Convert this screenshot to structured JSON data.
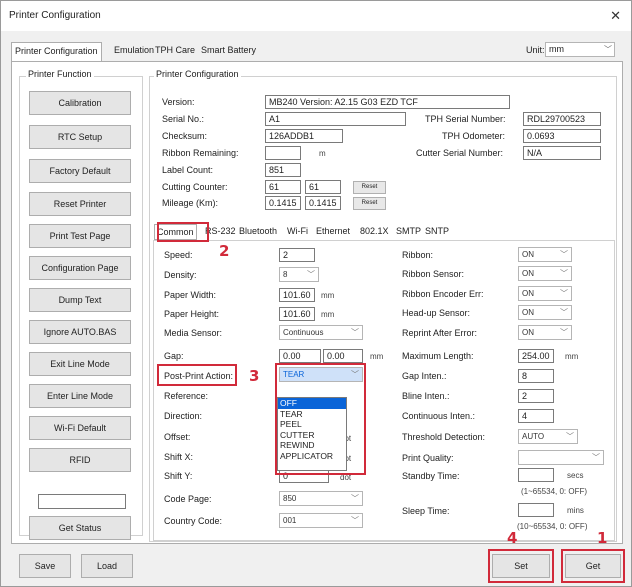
{
  "window": {
    "title": "Printer Configuration"
  },
  "tabs": [
    "Printer Configuration",
    "Emulation",
    "TPH Care",
    "Smart Battery"
  ],
  "unit": {
    "label": "Unit:",
    "value": "mm"
  },
  "printer_function": {
    "title": "Printer Function",
    "buttons": [
      "Calibration",
      "RTC Setup",
      "Factory Default",
      "Reset Printer",
      "Print Test Page",
      "Configuration Page",
      "Dump Text",
      "Ignore AUTO.BAS",
      "Exit Line Mode",
      "Enter Line Mode",
      "Wi-Fi Default",
      "RFID"
    ],
    "get_status": "Get Status"
  },
  "config": {
    "title": "Printer Configuration",
    "version": {
      "label": "Version:",
      "value": "MB240 Version: A2.15 G03 EZD TCF"
    },
    "serial_no": {
      "label": "Serial No.:",
      "value": "A1"
    },
    "checksum": {
      "label": "Checksum:",
      "value": "126ADDB1"
    },
    "ribbon_remaining": {
      "label": "Ribbon Remaining:",
      "value": "",
      "unit": "m"
    },
    "label_count": {
      "label": "Label Count:",
      "value": "851"
    },
    "cutting_counter": {
      "label": "Cutting Counter:",
      "value1": "61",
      "value2": "61",
      "reset": "Reset"
    },
    "mileage": {
      "label": "Mileage (Km):",
      "value1": "0.1415",
      "value2": "0.1415",
      "reset": "Reset"
    },
    "tph_serial": {
      "label": "TPH Serial Number:",
      "value": "RDL29700523"
    },
    "tph_odometer": {
      "label": "TPH Odometer:",
      "value": "0.0693"
    },
    "cutter_serial": {
      "label": "Cutter Serial Number:",
      "value": "N/A"
    }
  },
  "subtabs": [
    "Common",
    "RS-232",
    "Bluetooth",
    "Wi-Fi",
    "Ethernet",
    "802.1X",
    "SMTP",
    "SNTP"
  ],
  "common": {
    "speed": {
      "label": "Speed:",
      "value": "2"
    },
    "density": {
      "label": "Density:",
      "value": "8"
    },
    "paper_width": {
      "label": "Paper Width:",
      "value": "101.60",
      "unit": "mm"
    },
    "paper_height": {
      "label": "Paper Height:",
      "value": "101.60",
      "unit": "mm"
    },
    "media_sensor": {
      "label": "Media Sensor:",
      "value": "Continuous"
    },
    "gap": {
      "label": "Gap:",
      "value1": "0.00",
      "value2": "0.00",
      "unit": "mm"
    },
    "post_print_action": {
      "label": "Post-Print Action:",
      "value": "TEAR",
      "options": [
        "OFF",
        "TEAR",
        "PEEL",
        "CUTTER",
        "REWIND",
        "APPLICATOR"
      ],
      "selected_index": 0
    },
    "reference": {
      "label": "Reference:"
    },
    "direction": {
      "label": "Direction:"
    },
    "offset": {
      "label": "Offset:",
      "unit": "dot"
    },
    "shift_x": {
      "label": "Shift X:",
      "unit": "dot"
    },
    "shift_y": {
      "label": "Shift Y:",
      "value": "0",
      "unit": "dot"
    },
    "code_page": {
      "label": "Code Page:",
      "value": "850"
    },
    "country_code": {
      "label": "Country Code:",
      "value": "001"
    },
    "ribbon": {
      "label": "Ribbon:",
      "value": "ON"
    },
    "ribbon_sensor": {
      "label": "Ribbon Sensor:",
      "value": "ON"
    },
    "ribbon_encoder_err": {
      "label": "Ribbon Encoder Err:",
      "value": "ON"
    },
    "head_up_sensor": {
      "label": "Head-up Sensor:",
      "value": "ON"
    },
    "reprint_after_error": {
      "label": "Reprint After Error:",
      "value": "ON"
    },
    "maximum_length": {
      "label": "Maximum Length:",
      "value": "254.00",
      "unit": "mm"
    },
    "gap_inten": {
      "label": "Gap Inten.:",
      "value": "8"
    },
    "bline_inten": {
      "label": "Bline Inten.:",
      "value": "2"
    },
    "continuous_inten": {
      "label": "Continuous Inten.:",
      "value": "4"
    },
    "threshold_detection": {
      "label": "Threshold Detection:",
      "value": "AUTO"
    },
    "print_quality": {
      "label": "Print Quality:",
      "value": ""
    },
    "standby_time": {
      "label": "Standby Time:",
      "value": "",
      "unit": "secs",
      "hint": "(1~65534, 0: OFF)"
    },
    "sleep_time": {
      "label": "Sleep Time:",
      "value": "",
      "unit": "mins",
      "hint": "(10~65534, 0: OFF)"
    }
  },
  "buttons": {
    "save": "Save",
    "load": "Load",
    "set": "Set",
    "get": "Get"
  },
  "annotations": [
    "1",
    "2",
    "3",
    "4"
  ]
}
